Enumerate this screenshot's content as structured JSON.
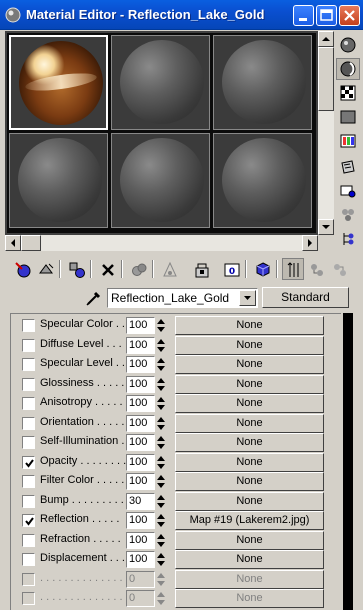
{
  "window": {
    "title": "Material Editor - Reflection_Lake_Gold",
    "minimize_icon": "minimize-icon",
    "maximize_icon": "maximize-icon",
    "close_icon": "close-icon"
  },
  "preview": {
    "slots": [
      {
        "name": "Reflection_Lake_Gold",
        "style": "gold",
        "active": true
      },
      {
        "style": "gray",
        "active": false
      },
      {
        "style": "gray",
        "active": false
      },
      {
        "style": "gray",
        "active": false
      },
      {
        "style": "gray",
        "active": false
      },
      {
        "style": "gray",
        "active": false
      }
    ]
  },
  "side_toolbar": [
    {
      "icon": "sample-type-sphere-icon",
      "pressed": false
    },
    {
      "icon": "backlight-icon",
      "pressed": true
    },
    {
      "icon": "background-checker-icon",
      "pressed": false
    },
    {
      "icon": "sample-uv-tiling-icon",
      "pressed": false
    },
    {
      "icon": "video-color-check-icon",
      "pressed": false
    },
    {
      "icon": "make-preview-icon",
      "pressed": false
    },
    {
      "icon": "options-icon",
      "pressed": false
    },
    {
      "icon": "select-by-material-icon",
      "pressed": false
    },
    {
      "icon": "material-map-navigator-icon",
      "pressed": false
    }
  ],
  "bottom_toolbar": [
    {
      "icon": "get-material-icon"
    },
    {
      "icon": "put-to-scene-icon"
    },
    {
      "icon": "assign-to-selection-icon"
    },
    {
      "icon": "reset-map-icon"
    },
    {
      "icon": "make-unique-icon"
    },
    {
      "icon": "put-to-library-icon"
    },
    {
      "icon": "material-effects-channel-icon"
    },
    {
      "icon": "show-map-in-viewport-icon"
    },
    {
      "icon": "show-end-result-icon",
      "pressed": true
    },
    {
      "icon": "go-to-parent-icon"
    },
    {
      "icon": "go-forward-to-sibling-icon"
    }
  ],
  "material": {
    "name": "Reflection_Lake_Gold",
    "type_button": "Standard"
  },
  "maps": [
    {
      "label": "Specular Color . .",
      "amount": "100",
      "map": "None",
      "checked": false,
      "enabled": true
    },
    {
      "label": "Diffuse Level . . .",
      "amount": "100",
      "map": "None",
      "checked": false,
      "enabled": true
    },
    {
      "label": "Specular Level . .",
      "amount": "100",
      "map": "None",
      "checked": false,
      "enabled": true
    },
    {
      "label": "Glossiness . . . . .",
      "amount": "100",
      "map": "None",
      "checked": false,
      "enabled": true
    },
    {
      "label": "Anisotropy . . . . .",
      "amount": "100",
      "map": "None",
      "checked": false,
      "enabled": true
    },
    {
      "label": "Orientation . . . . .",
      "amount": "100",
      "map": "None",
      "checked": false,
      "enabled": true
    },
    {
      "label": "Self-Illumination .",
      "amount": "100",
      "map": "None",
      "checked": false,
      "enabled": true
    },
    {
      "label": "Opacity . . . . . . . .",
      "amount": "100",
      "map": "None",
      "checked": true,
      "enabled": true
    },
    {
      "label": "Filter Color . . . . .",
      "amount": "100",
      "map": "None",
      "checked": false,
      "enabled": true
    },
    {
      "label": "Bump . . . . . . . . .",
      "amount": "30",
      "map": "None",
      "checked": false,
      "enabled": true
    },
    {
      "label": "Reflection . . . . .",
      "amount": "100",
      "map": "Map #19 (Lakerem2.jpg)",
      "checked": true,
      "enabled": true
    },
    {
      "label": "Refraction . . . . .",
      "amount": "100",
      "map": "None",
      "checked": false,
      "enabled": true
    },
    {
      "label": "Displacement . . .",
      "amount": "100",
      "map": "None",
      "checked": false,
      "enabled": true
    },
    {
      "label": ". . . . . . . . . . . . . .",
      "amount": "0",
      "map": "None",
      "checked": false,
      "enabled": false
    },
    {
      "label": ". . . . . . . . . . . . . .",
      "amount": "0",
      "map": "None",
      "checked": false,
      "enabled": false
    }
  ]
}
